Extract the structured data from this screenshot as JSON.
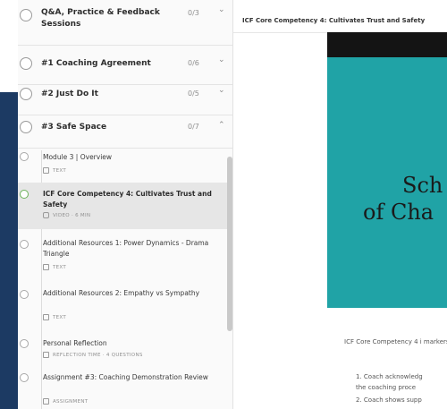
{
  "topbar": {
    "title": "ICF Core Competency 4: Cultivates Trust and Safety"
  },
  "sections": [
    {
      "title": "Q&A, Practice & Feedback Sessions",
      "count": "0/3",
      "chevron": "⌄"
    },
    {
      "title": "#1 Coaching Agreement",
      "count": "0/6",
      "chevron": "⌄"
    },
    {
      "title": "#2 Just Do It",
      "count": "0/5",
      "chevron": "⌄"
    },
    {
      "title": "#3 Safe Space",
      "count": "0/7",
      "chevron": "⌃"
    }
  ],
  "lessons": [
    {
      "title": "Module 3 | Overview",
      "meta": "TEXT"
    },
    {
      "title": "ICF Core Competency 4: Cultivates Trust and Safety",
      "meta": "VIDEO · 6 MIN"
    },
    {
      "title": "Additional Resources 1: Power Dynamics - Drama Triangle",
      "meta": "TEXT"
    },
    {
      "title": "Additional Resources 2: Empathy vs Sympathy",
      "meta": "TEXT"
    },
    {
      "title": "Personal Reflection",
      "meta": "REFLECTION TIME · 4 QUESTIONS"
    },
    {
      "title": "Assignment #3: Coaching Demonstration Review",
      "meta": "ASSIGNMENT"
    }
  ],
  "video": {
    "line1": "Sch",
    "line2": "of Cha"
  },
  "content": {
    "intro": "ICF Core Competency 4 i markers:",
    "items": [
      "1. Coach acknowledg",
      "the coaching proce",
      "2. Coach shows supp"
    ]
  },
  "colors": {
    "accent_green": "#6db35a",
    "navy": "#1c3a63",
    "teal": "#20a3a6"
  },
  "icons": {
    "section_status": "circle-icon",
    "expand": "chevron-down-icon",
    "collapse": "chevron-up-icon",
    "text_lesson": "document-icon",
    "video_lesson": "video-icon"
  }
}
